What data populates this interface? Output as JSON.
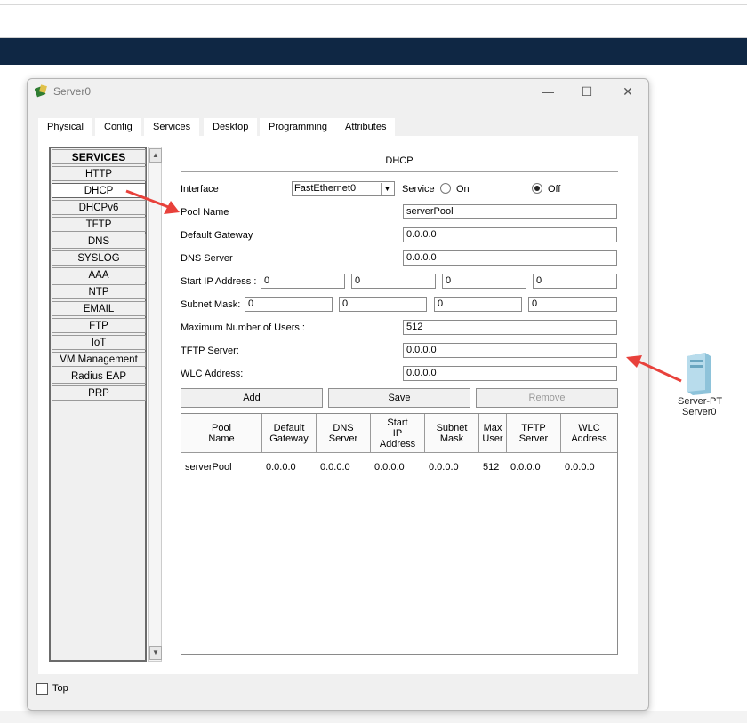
{
  "window": {
    "title": "Server0",
    "controls": [
      "minimize",
      "maximize",
      "close"
    ]
  },
  "tabs": [
    {
      "label": "Physical"
    },
    {
      "label": "Config"
    },
    {
      "label": "Services"
    },
    {
      "label": "Desktop"
    },
    {
      "label": "Programming"
    },
    {
      "label": "Attributes"
    }
  ],
  "active_tab": "Services",
  "services": {
    "header": "SERVICES",
    "items": [
      "HTTP",
      "DHCP",
      "DHCPv6",
      "TFTP",
      "DNS",
      "SYSLOG",
      "AAA",
      "NTP",
      "EMAIL",
      "FTP",
      "IoT",
      "VM Management",
      "Radius EAP",
      "PRP"
    ],
    "selected": "DHCP"
  },
  "dhcp": {
    "title": "DHCP",
    "interface_label": "Interface",
    "interface_value": "FastEthernet0",
    "service_label": "Service",
    "on_label": "On",
    "off_label": "Off",
    "service_state": "Off",
    "pool_name_label": "Pool Name",
    "pool_name_value": "serverPool",
    "default_gateway_label": "Default Gateway",
    "default_gateway_value": "0.0.0.0",
    "dns_server_label": "DNS Server",
    "dns_server_value": "0.0.0.0",
    "start_ip_label": "Start IP Address :",
    "start_ip": [
      "0",
      "0",
      "0",
      "0"
    ],
    "subnet_mask_label": "Subnet Mask:",
    "subnet_mask": [
      "0",
      "0",
      "0",
      "0"
    ],
    "max_users_label": "Maximum Number of Users :",
    "max_users_value": "512",
    "tftp_label": "TFTP Server:",
    "tftp_value": "0.0.0.0",
    "wlc_label": "WLC Address:",
    "wlc_value": "0.0.0.0",
    "buttons": {
      "add": "Add",
      "save": "Save",
      "remove": "Remove"
    }
  },
  "pool_table": {
    "columns": [
      "Pool Name",
      "Default Gateway",
      "DNS Server",
      "Start IP Address",
      "Subnet Mask",
      "Max User",
      "TFTP Server",
      "WLC Address"
    ],
    "header_lines": [
      [
        "Pool",
        "Name"
      ],
      [
        "Default",
        "Gateway"
      ],
      [
        "DNS",
        "Server"
      ],
      [
        "Start",
        "IP",
        "Address"
      ],
      [
        "Subnet",
        "Mask"
      ],
      [
        "Max",
        "User"
      ],
      [
        "TFTP",
        "Server"
      ],
      [
        "WLC",
        "Address"
      ]
    ],
    "rows": [
      [
        "serverPool",
        "0.0.0.0",
        "0.0.0.0",
        "0.0.0.0",
        "0.0.0.0",
        "512",
        "0.0.0.0",
        "0.0.0.0"
      ]
    ]
  },
  "footer": {
    "top_checkbox_label": "Top",
    "top_checked": false
  },
  "workspace_device": {
    "type_label": "Server-PT",
    "name_label": "Server0"
  },
  "colors": {
    "nav_band": "#0f2744",
    "annotation_arrow": "#e8413b",
    "server_icon": "#a9d3e6"
  },
  "icons": [
    "app-icon",
    "minimize-icon",
    "maximize-icon",
    "close-icon",
    "dropdown-arrow-icon",
    "scroll-up-icon",
    "scroll-down-icon",
    "server-device-icon",
    "annotation-arrow-icon"
  ]
}
